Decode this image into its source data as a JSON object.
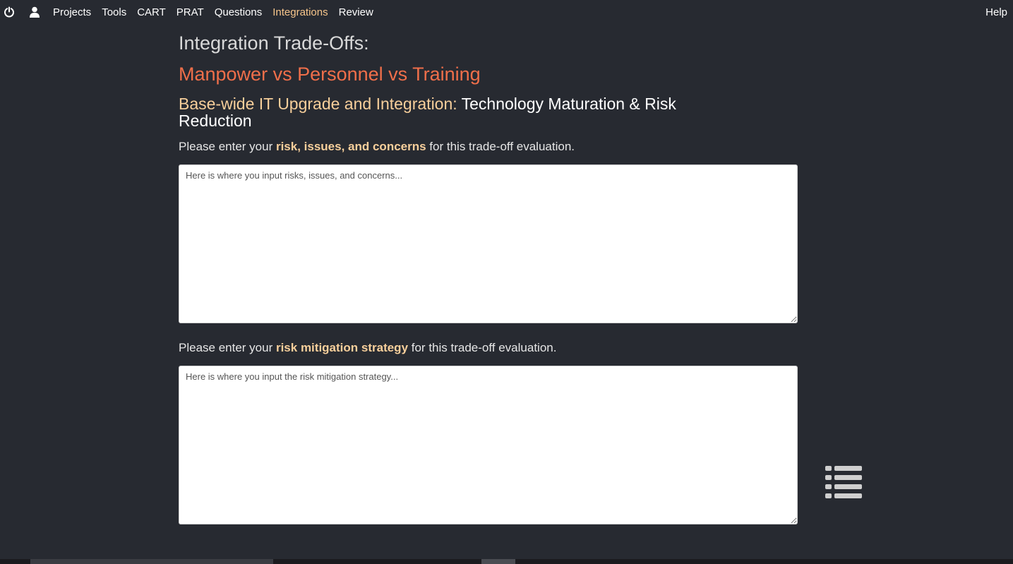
{
  "nav": {
    "power_icon": "power-icon",
    "user_icon": "user-icon",
    "links": [
      {
        "label": "Projects",
        "active": false
      },
      {
        "label": "Tools",
        "active": false
      },
      {
        "label": "CART",
        "active": false
      },
      {
        "label": "PRAT",
        "active": false
      },
      {
        "label": "Questions",
        "active": false
      },
      {
        "label": "Integrations",
        "active": true
      },
      {
        "label": "Review",
        "active": false
      }
    ],
    "help_label": "Help",
    "active_color": "#f7c58b"
  },
  "page": {
    "title": "Integration Trade-Offs:",
    "subtitle": "Manpower vs Personnel vs Training",
    "project_name": "Base-wide IT Upgrade and Integration:",
    "category": " Technology Maturation & Risk Reduction",
    "subtitle_color": "#f06f4a",
    "highlight_color": "#f7cf9b"
  },
  "risks": {
    "prompt_before": "Please enter your ",
    "prompt_bold": "risk, issues, and concerns",
    "prompt_after": " for this trade-off evaluation.",
    "placeholder": "Here is where you input risks, issues, and concerns...",
    "value": ""
  },
  "mitigation": {
    "prompt_before": "Please enter your ",
    "prompt_bold": "risk mitigation strategy",
    "prompt_after": " for this trade-off evaluation.",
    "placeholder": "Here is where you input the risk mitigation strategy...",
    "value": ""
  },
  "floating": {
    "list_icon": "list-icon"
  }
}
